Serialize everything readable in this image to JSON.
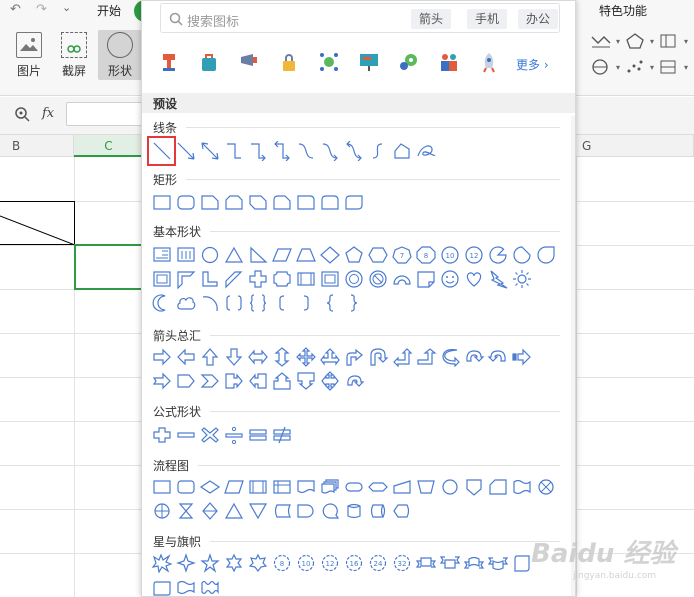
{
  "ribbon": {
    "tab_start": "开始",
    "tab_feature": "特色功能",
    "buttons": [
      {
        "label": "图片"
      },
      {
        "label": "截屏"
      },
      {
        "label": "形状"
      }
    ]
  },
  "formula_bar": {
    "fx_label": "fx"
  },
  "sheet": {
    "columns": [
      "B",
      "C",
      "G"
    ]
  },
  "panel": {
    "search_placeholder": "搜索图标",
    "chips": [
      "箭头",
      "手机",
      "办公"
    ],
    "more_label": "更多",
    "preset_label": "预设",
    "groups": [
      {
        "title": "线条"
      },
      {
        "title": "矩形"
      },
      {
        "title": "基本形状"
      },
      {
        "title": "箭头总汇"
      },
      {
        "title": "公式形状"
      },
      {
        "title": "流程图"
      },
      {
        "title": "星与旗帜"
      }
    ],
    "star_numbers": [
      "8",
      "10",
      "12",
      "16",
      "24",
      "32"
    ],
    "basic_numbers": [
      "7",
      "8",
      "10",
      "12"
    ],
    "icon_names": [
      "podium-icon",
      "bag-icon",
      "announce-icon",
      "lock-icon",
      "network-icon",
      "presentation-icon",
      "gears-icon",
      "people-icon",
      "rocket-icon"
    ]
  },
  "colors": {
    "shape_stroke": "#4a7bd0",
    "selection_green": "#2e9a44",
    "highlight_red": "#e23a3a",
    "link_blue": "#3c78d8"
  },
  "watermark": {
    "brand": "Baidu 经验",
    "url": "jingyan.baidu.com"
  }
}
